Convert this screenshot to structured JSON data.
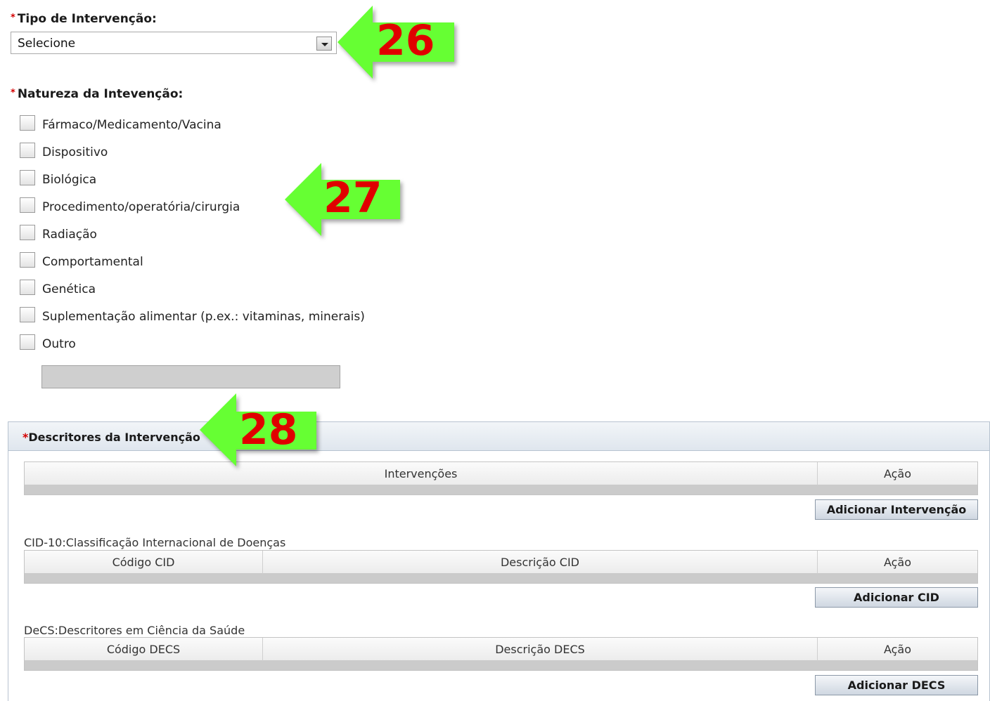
{
  "tipo": {
    "required_mark": "*",
    "label": "Tipo de Intervenção:",
    "select_value": "Selecione"
  },
  "natureza": {
    "required_mark": "*",
    "label": "Natureza da Intevenção:",
    "options": [
      {
        "label": "Fármaco/Medicamento/Vacina",
        "checked": false
      },
      {
        "label": "Dispositivo",
        "checked": false
      },
      {
        "label": "Biológica",
        "checked": false
      },
      {
        "label": "Procedimento/operatória/cirurgia",
        "checked": false
      },
      {
        "label": "Radiação",
        "checked": false
      },
      {
        "label": "Comportamental",
        "checked": false
      },
      {
        "label": "Genética",
        "checked": false
      },
      {
        "label": "Suplementação alimentar (p.ex.: vitaminas, minerais)",
        "checked": false
      },
      {
        "label": "Outro",
        "checked": false
      }
    ],
    "other_value": ""
  },
  "callouts": {
    "c26": "26",
    "c27": "27",
    "c28": "28",
    "arrow_color": "#66ff33",
    "number_color": "#e00000"
  },
  "descritores": {
    "required_mark": "*",
    "title": "Descritores da Intervenção",
    "intervencoes_table": {
      "columns": [
        "Intervenções",
        "Ação"
      ],
      "rows": []
    },
    "add_intervencao": "Adicionar Intervenção",
    "cid_label": "CID-10:Classificação Internacional de Doenças",
    "cid_table": {
      "columns": [
        "Código CID",
        "Descrição CID",
        "Ação"
      ],
      "rows": []
    },
    "add_cid": "Adicionar CID",
    "decs_label": "DeCS:Descritores em Ciência da Saúde",
    "decs_table": {
      "columns": [
        "Código DECS",
        "Descrição DECS",
        "Ação"
      ],
      "rows": []
    },
    "add_decs": "Adicionar DECS"
  }
}
